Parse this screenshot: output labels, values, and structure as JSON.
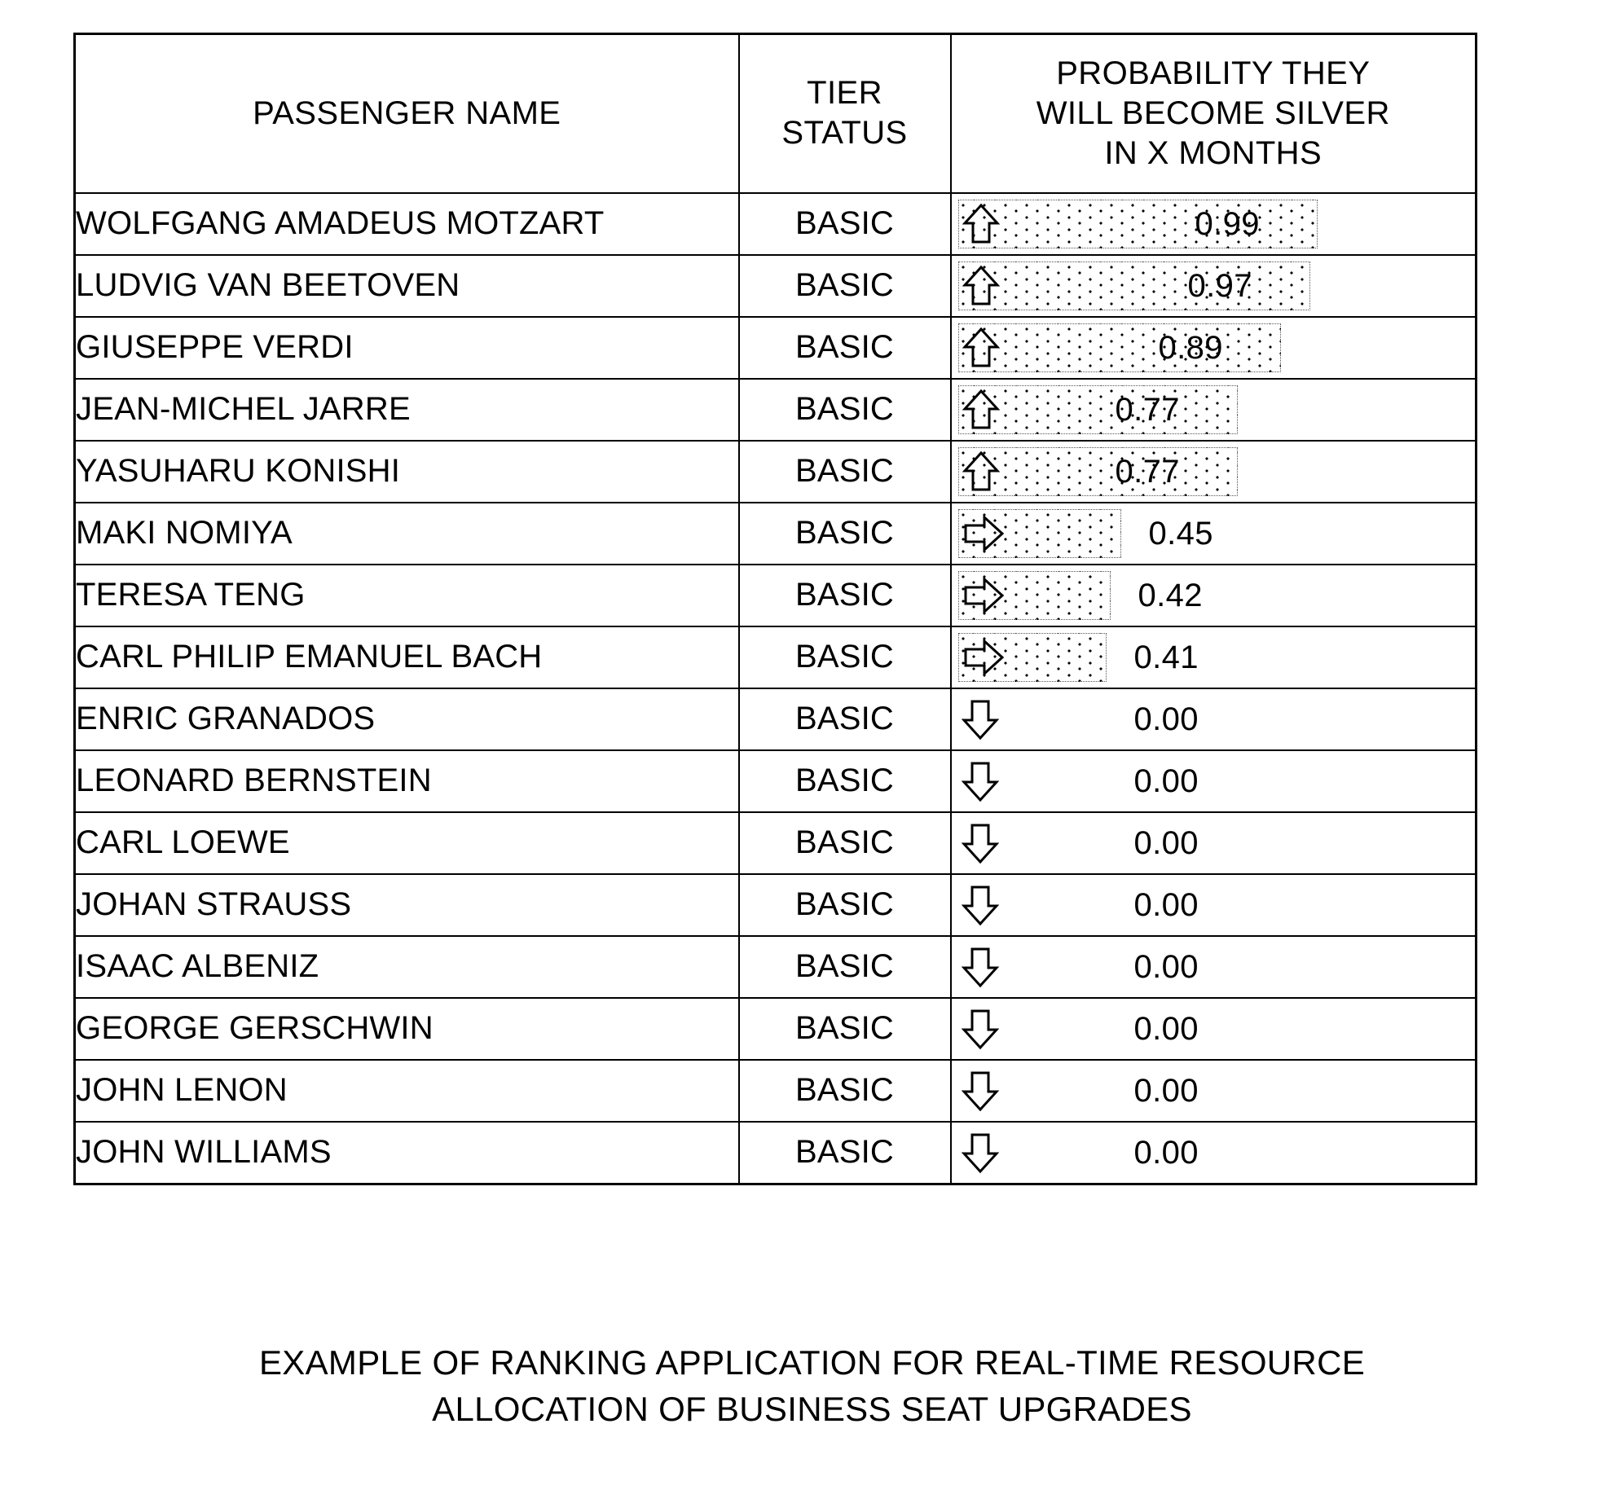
{
  "table": {
    "columns": [
      {
        "key": "passenger_name",
        "label": "PASSENGER NAME"
      },
      {
        "key": "tier_status",
        "label_line1": "TIER",
        "label_line2": "STATUS"
      },
      {
        "key": "probability",
        "label_line1": "PROBABILITY THEY",
        "label_line2": "WILL BECOME SILVER",
        "label_line3": "IN X MONTHS"
      }
    ],
    "rows": [
      {
        "name": "WOLFGANG AMADEUS MOTZART",
        "tier": "BASIC",
        "probability": "0.99",
        "trend": "up-arrow-icon",
        "bar": true
      },
      {
        "name": "LUDVIG VAN BEETOVEN",
        "tier": "BASIC",
        "probability": "0.97",
        "trend": "up-arrow-icon",
        "bar": true
      },
      {
        "name": "GIUSEPPE VERDI",
        "tier": "BASIC",
        "probability": "0.89",
        "trend": "up-arrow-icon",
        "bar": true
      },
      {
        "name": "JEAN-MICHEL JARRE",
        "tier": "BASIC",
        "probability": "0.77",
        "trend": "up-arrow-icon",
        "bar": true
      },
      {
        "name": "YASUHARU KONISHI",
        "tier": "BASIC",
        "probability": "0.77",
        "trend": "up-arrow-icon",
        "bar": true
      },
      {
        "name": "MAKI NOMIYA",
        "tier": "BASIC",
        "probability": "0.45",
        "trend": "right-arrow-icon",
        "bar": true
      },
      {
        "name": "TERESA TENG",
        "tier": "BASIC",
        "probability": "0.42",
        "trend": "right-arrow-icon",
        "bar": true
      },
      {
        "name": "CARL PHILIP EMANUEL BACH",
        "tier": "BASIC",
        "probability": "0.41",
        "trend": "right-arrow-icon",
        "bar": true
      },
      {
        "name": "ENRIC GRANADOS",
        "tier": "BASIC",
        "probability": "0.00",
        "trend": "down-arrow-icon",
        "bar": false
      },
      {
        "name": "LEONARD BERNSTEIN",
        "tier": "BASIC",
        "probability": "0.00",
        "trend": "down-arrow-icon",
        "bar": false
      },
      {
        "name": "CARL LOEWE",
        "tier": "BASIC",
        "probability": "0.00",
        "trend": "down-arrow-icon",
        "bar": false
      },
      {
        "name": "JOHAN STRAUSS",
        "tier": "BASIC",
        "probability": "0.00",
        "trend": "down-arrow-icon",
        "bar": false
      },
      {
        "name": "ISAAC ALBENIZ",
        "tier": "BASIC",
        "probability": "0.00",
        "trend": "down-arrow-icon",
        "bar": false
      },
      {
        "name": "GEORGE GERSCHWIN",
        "tier": "BASIC",
        "probability": "0.00",
        "trend": "down-arrow-icon",
        "bar": false
      },
      {
        "name": "JOHN LENON",
        "tier": "BASIC",
        "probability": "0.00",
        "trend": "down-arrow-icon",
        "bar": false
      },
      {
        "name": "JOHN WILLIAMS",
        "tier": "BASIC",
        "probability": "0.00",
        "trend": "down-arrow-icon",
        "bar": false
      }
    ]
  },
  "caption": {
    "line1": "EXAMPLE OF RANKING APPLICATION FOR REAL-TIME RESOURCE",
    "line2": "ALLOCATION OF BUSINESS SEAT UPGRADES"
  },
  "chart_data": {
    "type": "bar",
    "title": "PROBABILITY THEY WILL BECOME SILVER IN X MONTHS",
    "xlabel": "",
    "ylabel": "PASSENGER NAME",
    "xlim": [
      0,
      1
    ],
    "grid": false,
    "legend": null,
    "orientation": "horizontal",
    "categories": [
      "WOLFGANG AMADEUS MOTZART",
      "LUDVIG VAN BEETOVEN",
      "GIUSEPPE VERDI",
      "JEAN-MICHEL JARRE",
      "YASUHARU KONISHI",
      "MAKI NOMIYA",
      "TERESA TENG",
      "CARL PHILIP EMANUEL BACH",
      "ENRIC GRANADOS",
      "LEONARD BERNSTEIN",
      "CARL LOEWE",
      "JOHAN STRAUSS",
      "ISAAC ALBENIZ",
      "GEORGE GERSCHWIN",
      "JOHN LENON",
      "JOHN WILLIAMS"
    ],
    "values": [
      0.99,
      0.97,
      0.89,
      0.77,
      0.77,
      0.45,
      0.42,
      0.41,
      0.0,
      0.0,
      0.0,
      0.0,
      0.0,
      0.0,
      0.0,
      0.0
    ],
    "trend_markers": [
      "up",
      "up",
      "up",
      "up",
      "up",
      "right",
      "right",
      "right",
      "down",
      "down",
      "down",
      "down",
      "down",
      "down",
      "down",
      "down"
    ]
  },
  "colors": {
    "ink": "#000000",
    "paper": "#ffffff",
    "bar_dot": "#000000",
    "bar_border": "#555555"
  }
}
